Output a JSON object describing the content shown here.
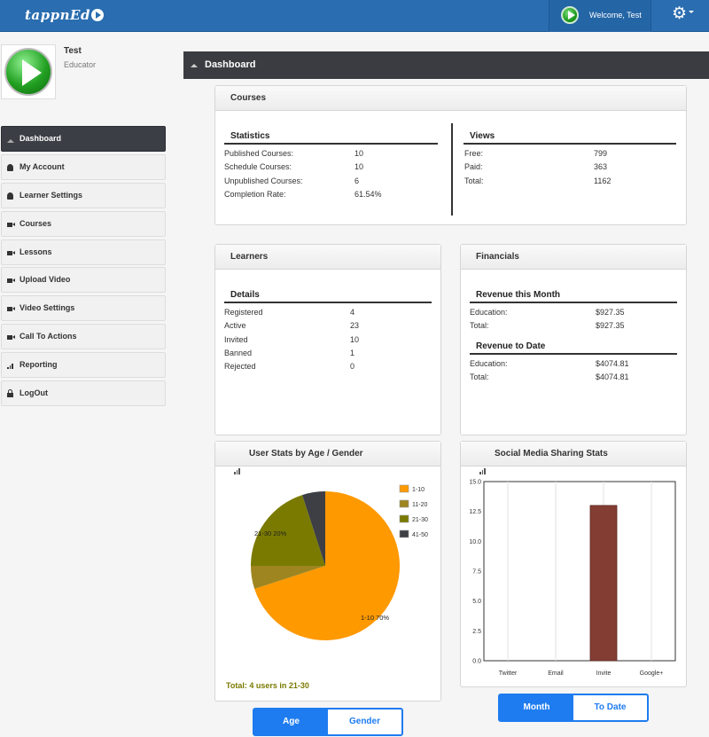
{
  "header": {
    "logo": "tappnEd",
    "welcome": "Welcome, Test"
  },
  "user": {
    "name": "Test",
    "role": "Educator"
  },
  "nav": [
    {
      "label": "Dashboard",
      "icon": "home-icon"
    },
    {
      "label": "My Account",
      "icon": "user-icon"
    },
    {
      "label": "Learner Settings",
      "icon": "user-icon"
    },
    {
      "label": "Courses",
      "icon": "video-camera-icon"
    },
    {
      "label": "Lessons",
      "icon": "video-camera-icon"
    },
    {
      "label": "Upload Video",
      "icon": "video-camera-icon"
    },
    {
      "label": "Video Settings",
      "icon": "video-camera-icon"
    },
    {
      "label": "Call To Actions",
      "icon": "video-camera-icon"
    },
    {
      "label": "Reporting",
      "icon": "bar-chart-icon"
    },
    {
      "label": "LogOut",
      "icon": "lock-icon"
    }
  ],
  "page_title": "Dashboard",
  "courses": {
    "title": "Courses",
    "statistics": {
      "title": "Statistics",
      "rows": [
        [
          "Published Courses:",
          "10"
        ],
        [
          "Schedule Courses:",
          "10"
        ],
        [
          "Unpublished Courses:",
          "6"
        ],
        [
          "Completion Rate:",
          "61.54%"
        ]
      ]
    },
    "views": {
      "title": "Views",
      "rows": [
        [
          "Free:",
          "799"
        ],
        [
          "Paid:",
          "363"
        ],
        [
          "Total:",
          "1162"
        ]
      ]
    }
  },
  "learners": {
    "title": "Learners",
    "details_title": "Details",
    "rows": [
      [
        "Registered",
        "4"
      ],
      [
        "Active",
        "23"
      ],
      [
        "Invited",
        "10"
      ],
      [
        "Banned",
        "1"
      ],
      [
        "Rejected",
        "0"
      ]
    ]
  },
  "financials": {
    "title": "Financials",
    "month": {
      "title": "Revenue this Month",
      "rows": [
        [
          "Education:",
          "$927.35"
        ],
        [
          "Total:",
          "$927.35"
        ]
      ]
    },
    "todate": {
      "title": "Revenue to Date",
      "rows": [
        [
          "Education:",
          "$4074.81"
        ],
        [
          "Total:",
          "$4074.81"
        ]
      ]
    }
  },
  "user_stats": {
    "title": "User Stats by Age / Gender",
    "total": "Total: 4 users in 21-30",
    "buttons": [
      "Age",
      "Gender"
    ]
  },
  "social": {
    "title": "Social Media Sharing Stats",
    "buttons": [
      "Month",
      "To Date"
    ]
  },
  "colors": {
    "header": "#2a6db0",
    "accent": "#1e7cf0",
    "pie": [
      "#ff9900",
      "#9e8520",
      "#7a7a00",
      "#3d3f45"
    ],
    "bar": "#843d32"
  },
  "chart_data": [
    {
      "type": "pie",
      "title": "User Stats by Age / Gender",
      "slices": [
        {
          "label": "1-10",
          "value": 70,
          "color": "#ff9900",
          "data_label": "1-10 70%"
        },
        {
          "label": "11-20",
          "value": 5,
          "color": "#9e8520"
        },
        {
          "label": "21-30",
          "value": 20,
          "color": "#7a7a00",
          "data_label": "21-30 20%"
        },
        {
          "label": "41-50",
          "value": 5,
          "color": "#3d3f45"
        }
      ],
      "legend": "top-right"
    },
    {
      "type": "bar",
      "title": "Social Media Sharing Stats",
      "categories": [
        "Twitter",
        "Email",
        "Invite",
        "Google+"
      ],
      "values": [
        0,
        0,
        13,
        0
      ],
      "ylim": [
        0,
        15
      ],
      "yticks": [
        "0.0",
        "2.5",
        "5.0",
        "7.5",
        "10.0",
        "12.5",
        "15.0"
      ],
      "grid": true
    }
  ]
}
